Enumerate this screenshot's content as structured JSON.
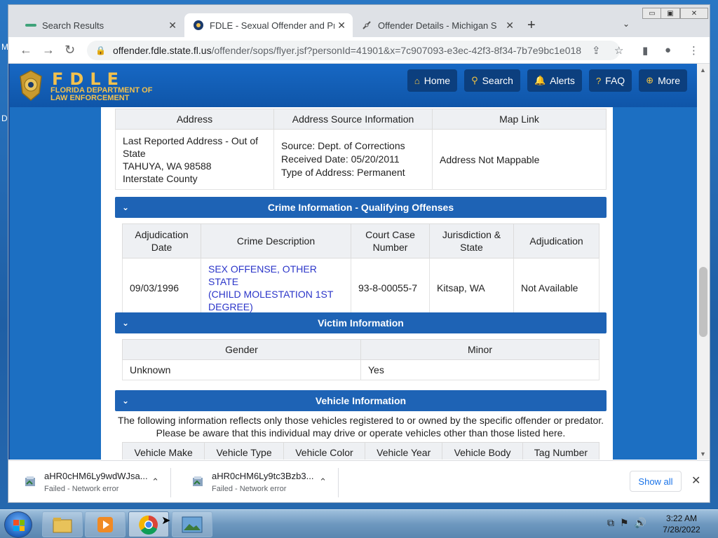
{
  "desktop": {
    "edge_letters": [
      "M",
      "D"
    ]
  },
  "browser": {
    "tabs": [
      {
        "title": "Search Results",
        "active": false
      },
      {
        "title": "FDLE - Sexual Offender and Predator",
        "active": true
      },
      {
        "title": "Offender Details - Michigan Sex Offender",
        "active": false
      }
    ],
    "new_tab_label": "+",
    "tab_menu_label": "⌄",
    "url_host": "offender.fdle.state.fl.us",
    "url_path": "/offender/sops/flyer.jsf?personId=41901&x=7c907093-e3ec-42f3-8f34-7b7e9bc1e018",
    "back": "←",
    "forward": "→",
    "reload": "↻",
    "lock": "🔒",
    "share": "⇪",
    "star": "☆",
    "sidepanel": "▮",
    "profile": "●",
    "menu": "⋮",
    "minimize": "▭",
    "maximize": "▣",
    "close": "✕"
  },
  "site": {
    "logo_title": "FDLE",
    "logo_subtitle_line1": "FLORIDA DEPARTMENT OF",
    "logo_subtitle_line2": "LAW ENFORCEMENT",
    "nav": [
      {
        "label": "Home",
        "icon": "⌂"
      },
      {
        "label": "Search",
        "icon": "⚲"
      },
      {
        "label": "Alerts",
        "icon": "🔔"
      },
      {
        "label": "FAQ",
        "icon": "?"
      },
      {
        "label": "More",
        "icon": "⊕"
      }
    ]
  },
  "address_table": {
    "headers": [
      "Address",
      "Address Source Information",
      "Map Link"
    ],
    "row": {
      "address_line1": "Last Reported Address - Out of",
      "address_line2": "State",
      "address_line3": "TAHUYA, WA 98588",
      "address_line4": "Interstate County",
      "source_line1": "Source: Dept. of Corrections",
      "source_line2": "Received Date: 05/20/2011",
      "source_line3": "Type of Address: Permanent",
      "map": "Address Not Mappable"
    }
  },
  "crime_section": {
    "title": "Crime Information - Qualifying Offenses",
    "headers": {
      "adj_date_1": "Adjudication",
      "adj_date_2": "Date",
      "desc": "Crime Description",
      "case_1": "Court Case",
      "case_2": "Number",
      "juris_1": "Jurisdiction &",
      "juris_2": "State",
      "adjudication": "Adjudication"
    },
    "row": {
      "date": "09/03/1996",
      "desc_1": "SEX OFFENSE, OTHER STATE",
      "desc_2": "(CHILD MOLESTATION 1ST",
      "desc_3": "DEGREE)",
      "case": "93-8-00055-7",
      "juris": "Kitsap, WA",
      "adjudication": "Not Available"
    }
  },
  "victim_section": {
    "title": "Victim Information",
    "headers": [
      "Gender",
      "Minor"
    ],
    "row": [
      "Unknown",
      "Yes"
    ]
  },
  "vehicle_section": {
    "title": "Vehicle Information",
    "note_line1": "The following information reflects only those vehicles registered to or owned by the specific offender or predator.",
    "note_line2": "Please be aware that this individual may drive or operate vehicles other than those listed here.",
    "headers": [
      "Vehicle Make",
      "Vehicle Type",
      "Vehicle Color",
      "Vehicle Year",
      "Vehicle Body",
      "Tag Number"
    ]
  },
  "section_chevron": "⌄",
  "downloads": [
    {
      "name": "aHR0cHM6Ly9wdWJsa...",
      "status": "Failed - Network error"
    },
    {
      "name": "aHR0cHM6Ly9tc3Bzb3...",
      "status": "Failed - Network error"
    }
  ],
  "download_caret": "⌃",
  "show_all": "Show all",
  "download_close": "✕",
  "taskbar": {
    "time": "3:22 AM",
    "date": "7/28/2022"
  },
  "colors": {
    "header_blue": "#1768c4",
    "section_blue": "#1e63b5",
    "logo_gold": "#f2c14e",
    "link_blue": "#2b35c9"
  }
}
